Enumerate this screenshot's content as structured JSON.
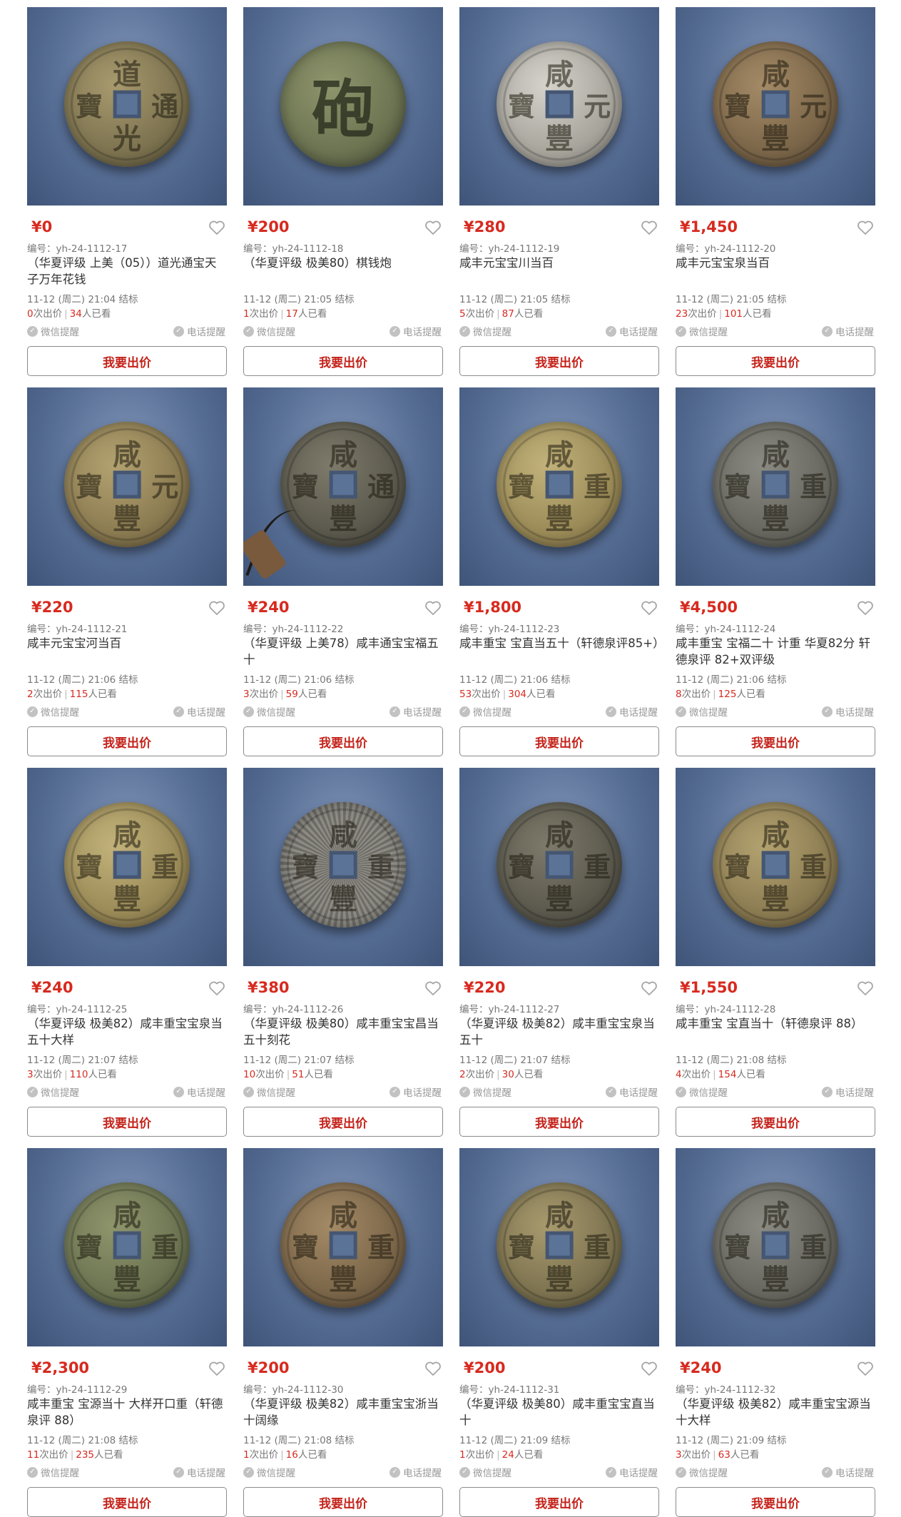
{
  "colors": {
    "price": "#d72a1f",
    "button_text": "#c4221a",
    "photo_bg": "#566d94"
  },
  "lots": [
    {
      "price": "¥0",
      "code": "编号：yh-24-1112-17",
      "title": "（华夏评级 上美（05））道光通宝天子万年花钱",
      "end_time": "11-12 (周二) 21:04 结标",
      "bids": "0",
      "bids_label": "次出价",
      "views": "34",
      "views_label": "人已看",
      "wechat": "微信提醒",
      "phone": "电话提醒",
      "bid_button": "我要出价",
      "coin": {
        "style": "bronze-dark",
        "glyphs": [
          "道",
          "光",
          "通",
          "寶"
        ],
        "icon": "heart-icon"
      }
    },
    {
      "price": "¥200",
      "code": "编号：yh-24-1112-18",
      "title": "（华夏评级 极美80）棋钱炮",
      "end_time": "11-12 (周二) 21:05 结标",
      "bids": "1",
      "bids_label": "次出价",
      "views": "17",
      "views_label": "人已看",
      "wechat": "微信提醒",
      "phone": "电话提醒",
      "bid_button": "我要出价",
      "coin": {
        "style": "green",
        "glyphs": [
          "砲"
        ]
      }
    },
    {
      "price": "¥280",
      "code": "编号：yh-24-1112-19",
      "title": "咸丰元宝宝川当百",
      "end_time": "11-12 (周二) 21:05 结标",
      "bids": "5",
      "bids_label": "次出价",
      "views": "87",
      "views_label": "人已看",
      "wechat": "微信提醒",
      "phone": "电话提醒",
      "bid_button": "我要出价",
      "coin": {
        "style": "silver",
        "glyphs": [
          "咸",
          "豐",
          "元",
          "寶"
        ]
      }
    },
    {
      "price": "¥1,450",
      "code": "编号：yh-24-1112-20",
      "title": "咸丰元宝宝泉当百",
      "end_time": "11-12 (周二) 21:05 结标",
      "bids": "23",
      "bids_label": "次出价",
      "views": "101",
      "views_label": "人已看",
      "wechat": "微信提醒",
      "phone": "电话提醒",
      "bid_button": "我要出价",
      "coin": {
        "style": "brown",
        "glyphs": [
          "咸",
          "豐",
          "元",
          "寶"
        ]
      }
    },
    {
      "price": "¥220",
      "code": "编号：yh-24-1112-21",
      "title": "咸丰元宝宝河当百",
      "end_time": "11-12 (周二) 21:06 结标",
      "bids": "2",
      "bids_label": "次出价",
      "views": "115",
      "views_label": "人已看",
      "wechat": "微信提醒",
      "phone": "电话提醒",
      "bid_button": "我要出价",
      "coin": {
        "style": "bronze",
        "glyphs": [
          "咸",
          "豐",
          "元",
          "寶"
        ]
      }
    },
    {
      "price": "¥240",
      "code": "编号：yh-24-1112-22",
      "title": "（华夏评级 上美78）咸丰通宝宝福五十",
      "end_time": "11-12 (周二) 21:06 结标",
      "bids": "3",
      "bids_label": "次出价",
      "views": "59",
      "views_label": "人已看",
      "wechat": "微信提醒",
      "phone": "电话提醒",
      "bid_button": "我要出价",
      "coin": {
        "style": "dark",
        "glyphs": [
          "咸",
          "豐",
          "通",
          "寶"
        ],
        "cord": true
      }
    },
    {
      "price": "¥1,800",
      "code": "编号：yh-24-1112-23",
      "title": "咸丰重宝 宝直当五十（轩德泉评85+）",
      "end_time": "11-12 (周二) 21:06 结标",
      "bids": "53",
      "bids_label": "次出价",
      "views": "304",
      "views_label": "人已看",
      "wechat": "微信提醒",
      "phone": "电话提醒",
      "bid_button": "我要出价",
      "coin": {
        "style": "brass",
        "glyphs": [
          "咸",
          "豐",
          "重",
          "寶"
        ]
      }
    },
    {
      "price": "¥4,500",
      "code": "编号：yh-24-1112-24",
      "title": "咸丰重宝 宝福二十 计重 华夏82分 轩德泉评 82+双评级",
      "end_time": "11-12 (周二) 21:06 结标",
      "bids": "8",
      "bids_label": "次出价",
      "views": "125",
      "views_label": "人已看",
      "wechat": "微信提醒",
      "phone": "电话提醒",
      "bid_button": "我要出价",
      "coin": {
        "style": "grey",
        "glyphs": [
          "咸",
          "豐",
          "重",
          "寶"
        ]
      }
    },
    {
      "price": "¥240",
      "code": "编号：yh-24-1112-25",
      "title": "（华夏评级 极美82）咸丰重宝宝泉当五十大样",
      "end_time": "11-12 (周二) 21:07 结标",
      "bids": "3",
      "bids_label": "次出价",
      "views": "110",
      "views_label": "人已看",
      "wechat": "微信提醒",
      "phone": "电话提醒",
      "bid_button": "我要出价",
      "coin": {
        "style": "brass",
        "glyphs": [
          "咸",
          "豐",
          "重",
          "寶"
        ]
      }
    },
    {
      "price": "¥380",
      "code": "编号：yh-24-1112-26",
      "title": "（华夏评级 极美80）咸丰重宝宝昌当五十刻花",
      "end_time": "11-12 (周二) 21:07 结标",
      "bids": "10",
      "bids_label": "次出价",
      "views": "51",
      "views_label": "人已看",
      "wechat": "微信提醒",
      "phone": "电话提醒",
      "bid_button": "我要出价",
      "coin": {
        "style": "engraved",
        "glyphs": [
          "咸",
          "豐",
          "重",
          "寶"
        ]
      }
    },
    {
      "price": "¥220",
      "code": "编号：yh-24-1112-27",
      "title": "（华夏评级 极美82）咸丰重宝宝泉当五十",
      "end_time": "11-12 (周二) 21:07 结标",
      "bids": "2",
      "bids_label": "次出价",
      "views": "30",
      "views_label": "人已看",
      "wechat": "微信提醒",
      "phone": "电话提醒",
      "bid_button": "我要出价",
      "coin": {
        "style": "dark",
        "glyphs": [
          "咸",
          "豐",
          "重",
          "寶"
        ]
      }
    },
    {
      "price": "¥1,550",
      "code": "编号：yh-24-1112-28",
      "title": "咸丰重宝 宝直当十（轩德泉评 88）",
      "end_time": "11-12 (周二) 21:08 结标",
      "bids": "4",
      "bids_label": "次出价",
      "views": "154",
      "views_label": "人已看",
      "wechat": "微信提醒",
      "phone": "电话提醒",
      "bid_button": "我要出价",
      "coin": {
        "style": "bronze",
        "glyphs": [
          "咸",
          "豐",
          "重",
          "寶"
        ]
      }
    },
    {
      "price": "¥2,300",
      "code": "编号：yh-24-1112-29",
      "title": "咸丰重宝 宝源当十 大样开口重（轩德泉评 88）",
      "end_time": "11-12 (周二) 21:08 结标",
      "bids": "11",
      "bids_label": "次出价",
      "views": "235",
      "views_label": "人已看",
      "wechat": "微信提醒",
      "phone": "电话提醒",
      "bid_button": "我要出价",
      "coin": {
        "style": "green",
        "glyphs": [
          "咸",
          "豐",
          "重",
          "寶"
        ]
      }
    },
    {
      "price": "¥200",
      "code": "编号：yh-24-1112-30",
      "title": "（华夏评级 极美82）咸丰重宝宝浙当十阔缘",
      "end_time": "11-12 (周二) 21:08 结标",
      "bids": "1",
      "bids_label": "次出价",
      "views": "16",
      "views_label": "人已看",
      "wechat": "微信提醒",
      "phone": "电话提醒",
      "bid_button": "我要出价",
      "coin": {
        "style": "brown",
        "glyphs": [
          "咸",
          "豐",
          "重",
          "寶"
        ]
      }
    },
    {
      "price": "¥200",
      "code": "编号：yh-24-1112-31",
      "title": "（华夏评级 极美80）咸丰重宝宝直当十",
      "end_time": "11-12 (周二) 21:09 结标",
      "bids": "1",
      "bids_label": "次出价",
      "views": "24",
      "views_label": "人已看",
      "wechat": "微信提醒",
      "phone": "电话提醒",
      "bid_button": "我要出价",
      "coin": {
        "style": "bronze-dark",
        "glyphs": [
          "咸",
          "豐",
          "重",
          "寶"
        ]
      }
    },
    {
      "price": "¥240",
      "code": "编号：yh-24-1112-32",
      "title": "（华夏评级 极美82）咸丰重宝宝源当十大样",
      "end_time": "11-12 (周二) 21:09 结标",
      "bids": "3",
      "bids_label": "次出价",
      "views": "63",
      "views_label": "人已看",
      "wechat": "微信提醒",
      "phone": "电话提醒",
      "bid_button": "我要出价",
      "coin": {
        "style": "grey",
        "glyphs": [
          "咸",
          "豐",
          "重",
          "寶"
        ]
      }
    }
  ]
}
